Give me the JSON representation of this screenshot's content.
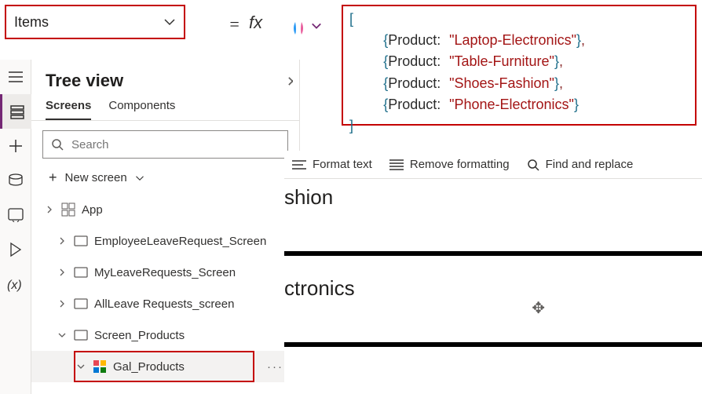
{
  "property_dropdown": {
    "value": "Items"
  },
  "formula": {
    "lines": [
      {
        "key": "Product",
        "value": "\"Laptop-Electronics\"",
        "trailingComma": true
      },
      {
        "key": "Product",
        "value": "\"Table-Furniture\"",
        "trailingComma": true
      },
      {
        "key": "Product",
        "value": "\"Shoes-Fashion\"",
        "trailingComma": true
      },
      {
        "key": "Product",
        "value": "\"Phone-Electronics\"",
        "trailingComma": false
      }
    ]
  },
  "tree_view": {
    "title": "Tree view",
    "tabs": {
      "screens": "Screens",
      "components": "Components",
      "active": "screens"
    },
    "search_placeholder": "Search",
    "new_screen_label": "New screen",
    "nodes": [
      {
        "label": "App",
        "icon": "app",
        "level": 1,
        "expandable": true
      },
      {
        "label": "EmployeeLeaveRequest_Screen",
        "icon": "screen",
        "level": 1,
        "expandable": true
      },
      {
        "label": "MyLeaveRequests_Screen",
        "icon": "screen",
        "level": 1,
        "expandable": true
      },
      {
        "label": "AllLeave Requests_screen",
        "icon": "screen",
        "level": 1,
        "expandable": true
      },
      {
        "label": "Screen_Products",
        "icon": "screen",
        "level": 1,
        "expandable": true,
        "expanded": true
      },
      {
        "label": "Gal_Products",
        "icon": "gallery",
        "level": 2,
        "expandable": true,
        "expanded": true,
        "selected": true
      }
    ]
  },
  "formula_toolbar": {
    "format": "Format text",
    "remove": "Remove formatting",
    "find": "Find and replace"
  },
  "canvas_text": {
    "partial1": "shion",
    "partial2": "ctronics"
  },
  "icons": {
    "search": "search-icon",
    "plus": "plus-icon",
    "chevron_down": "chevron-down-icon"
  }
}
